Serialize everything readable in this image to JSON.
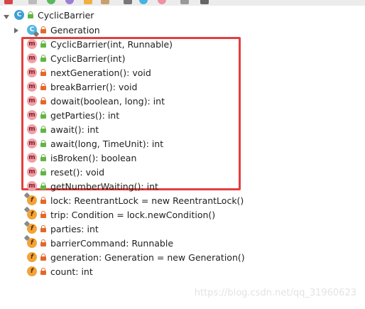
{
  "tree": {
    "root": {
      "label": "CyclicBarrier",
      "icon": "class-icon"
    },
    "inner_class": {
      "label": "Generation",
      "icon": "class-icon"
    },
    "methods": [
      {
        "label": "CyclicBarrier(int, Runnable)",
        "access": "public"
      },
      {
        "label": "CyclicBarrier(int)",
        "access": "public"
      },
      {
        "label": "nextGeneration(): void",
        "access": "private"
      },
      {
        "label": "breakBarrier(): void",
        "access": "private"
      },
      {
        "label": "dowait(boolean, long): int",
        "access": "private"
      },
      {
        "label": "getParties(): int",
        "access": "public"
      },
      {
        "label": "await(): int",
        "access": "public"
      },
      {
        "label": "await(long, TimeUnit): int",
        "access": "public"
      },
      {
        "label": "isBroken(): boolean",
        "access": "public"
      },
      {
        "label": "reset(): void",
        "access": "public"
      },
      {
        "label": "getNumberWaiting(): int",
        "access": "public"
      }
    ],
    "fields": [
      {
        "label": "lock: ReentrantLock = new ReentrantLock()",
        "access": "private",
        "final": true
      },
      {
        "label": "trip: Condition = lock.newCondition()",
        "access": "private",
        "final": true
      },
      {
        "label": "parties: int",
        "access": "private",
        "final": true
      },
      {
        "label": "barrierCommand: Runnable",
        "access": "private",
        "final": true
      },
      {
        "label": "generation: Generation = new Generation()",
        "access": "private",
        "final": false
      },
      {
        "label": "count: int",
        "access": "private",
        "final": false
      }
    ]
  },
  "watermark": "https://blog.csdn.net/qq_31960623",
  "colors": {
    "highlight_border": "#e2403f",
    "method_icon": "#f19fa5",
    "field_icon": "#f2a33a",
    "class_icon": "#3d9fd6",
    "public_lock": "#62b543",
    "private_lock": "#e2692a"
  }
}
